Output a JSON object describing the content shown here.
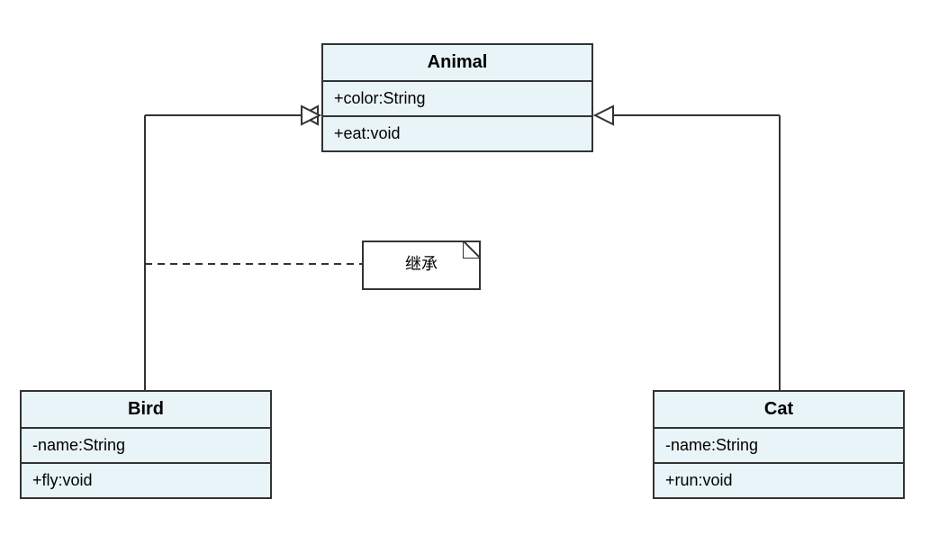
{
  "classes": {
    "animal": {
      "name": "Animal",
      "attribute": "+color:String",
      "method": "+eat:void"
    },
    "bird": {
      "name": "Bird",
      "attribute": "-name:String",
      "method": "+fly:void"
    },
    "cat": {
      "name": "Cat",
      "attribute": "-name:String",
      "method": "+run:void"
    }
  },
  "note": {
    "label": "继承"
  }
}
